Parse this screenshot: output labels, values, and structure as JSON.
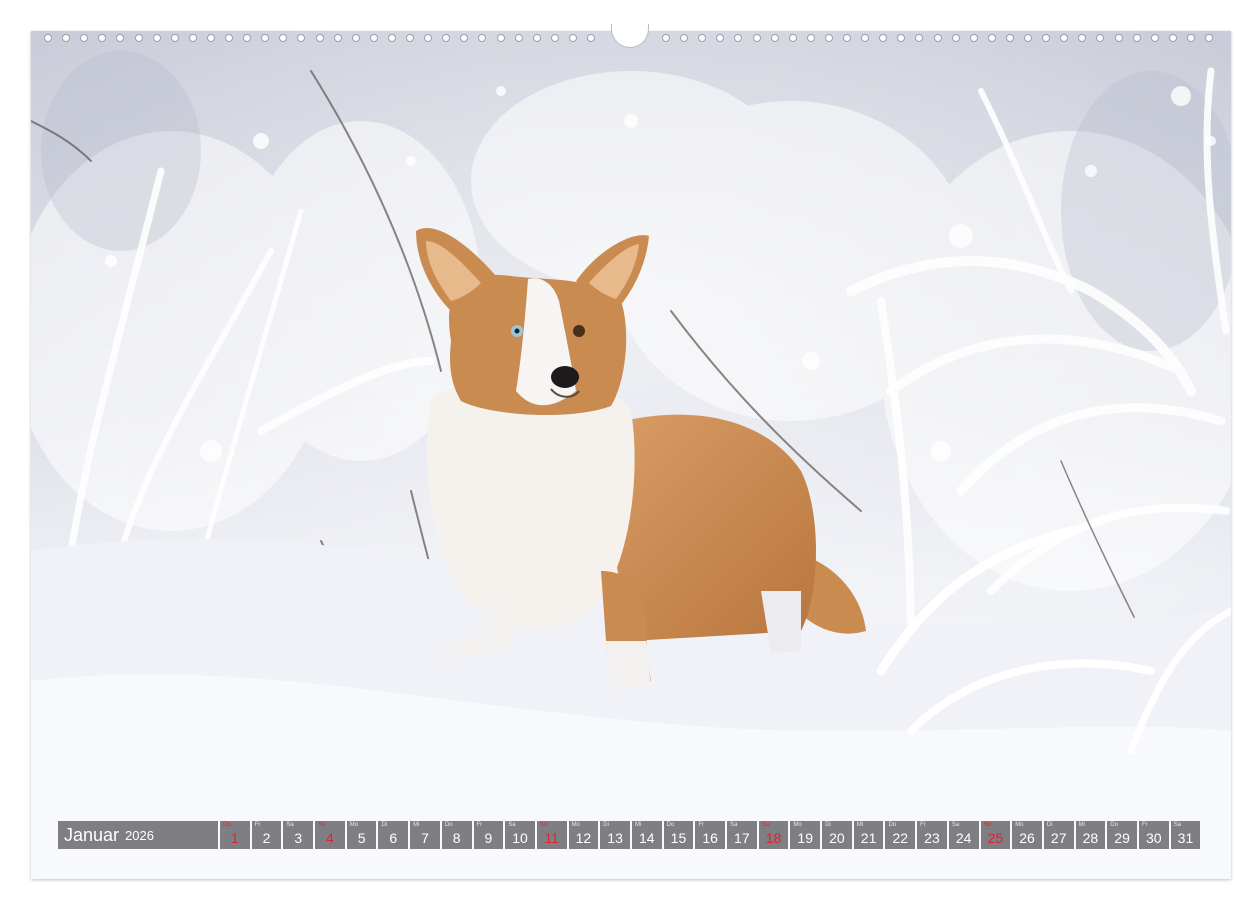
{
  "photo": {
    "subject": "dog-in-snow"
  },
  "calendar": {
    "month": "Januar",
    "year": "2026",
    "holiday_color": "#e1232b",
    "days": [
      {
        "wd": "Do",
        "num": "1",
        "holiday": true
      },
      {
        "wd": "Fr",
        "num": "2",
        "holiday": false
      },
      {
        "wd": "Sa",
        "num": "3",
        "holiday": false
      },
      {
        "wd": "So",
        "num": "4",
        "holiday": true
      },
      {
        "wd": "Mo",
        "num": "5",
        "holiday": false
      },
      {
        "wd": "Di",
        "num": "6",
        "holiday": false
      },
      {
        "wd": "Mi",
        "num": "7",
        "holiday": false
      },
      {
        "wd": "Do",
        "num": "8",
        "holiday": false
      },
      {
        "wd": "Fr",
        "num": "9",
        "holiday": false
      },
      {
        "wd": "Sa",
        "num": "10",
        "holiday": false
      },
      {
        "wd": "So",
        "num": "11",
        "holiday": true
      },
      {
        "wd": "Mo",
        "num": "12",
        "holiday": false
      },
      {
        "wd": "Di",
        "num": "13",
        "holiday": false
      },
      {
        "wd": "Mi",
        "num": "14",
        "holiday": false
      },
      {
        "wd": "Do",
        "num": "15",
        "holiday": false
      },
      {
        "wd": "Fr",
        "num": "16",
        "holiday": false
      },
      {
        "wd": "Sa",
        "num": "17",
        "holiday": false
      },
      {
        "wd": "So",
        "num": "18",
        "holiday": true
      },
      {
        "wd": "Mo",
        "num": "19",
        "holiday": false
      },
      {
        "wd": "Di",
        "num": "20",
        "holiday": false
      },
      {
        "wd": "Mi",
        "num": "21",
        "holiday": false
      },
      {
        "wd": "Do",
        "num": "22",
        "holiday": false
      },
      {
        "wd": "Fr",
        "num": "23",
        "holiday": false
      },
      {
        "wd": "Sa",
        "num": "24",
        "holiday": false
      },
      {
        "wd": "So",
        "num": "25",
        "holiday": true
      },
      {
        "wd": "Mo",
        "num": "26",
        "holiday": false
      },
      {
        "wd": "Di",
        "num": "27",
        "holiday": false
      },
      {
        "wd": "Mi",
        "num": "28",
        "holiday": false
      },
      {
        "wd": "Do",
        "num": "29",
        "holiday": false
      },
      {
        "wd": "Fr",
        "num": "30",
        "holiday": false
      },
      {
        "wd": "Sa",
        "num": "31",
        "holiday": false
      }
    ]
  }
}
